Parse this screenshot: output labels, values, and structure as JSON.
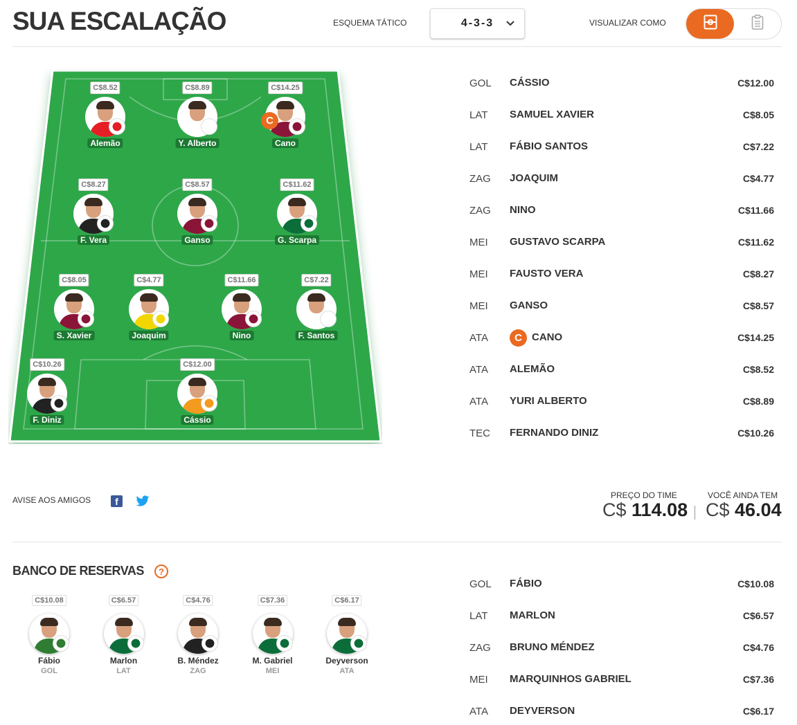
{
  "header": {
    "title": "SUA ESCALAÇÃO",
    "scheme_label": "ESQUEMA TÁTICO",
    "scheme_value": "4-3-3",
    "view_label": "VISUALIZAR COMO",
    "accent_color": "#ea6a21"
  },
  "field": {
    "players": [
      {
        "name": "Alemão",
        "price": "C$8.52",
        "shirt": "#e51f25",
        "club_icon": "internacional-badge-icon"
      },
      {
        "name": "Y. Alberto",
        "price": "C$8.89",
        "shirt": "#ffffff",
        "club_icon": "corinthians-badge-icon"
      },
      {
        "name": "Cano",
        "price": "C$14.25",
        "shirt": "#8a1538",
        "club_icon": "fluminense-badge-icon",
        "captain": "C"
      },
      {
        "name": "F. Vera",
        "price": "C$8.27",
        "shirt": "#222222",
        "club_icon": "corinthians-badge-icon"
      },
      {
        "name": "Ganso",
        "price": "C$8.57",
        "shirt": "#8a1538",
        "club_icon": "fluminense-badge-icon"
      },
      {
        "name": "G. Scarpa",
        "price": "C$11.62",
        "shirt": "#0b6e3a",
        "club_icon": "palmeiras-badge-icon"
      },
      {
        "name": "S. Xavier",
        "price": "C$8.05",
        "shirt": "#8a1538",
        "club_icon": "fluminense-badge-icon"
      },
      {
        "name": "Joaquim",
        "price": "C$4.77",
        "shirt": "#f2d600",
        "club_icon": "cuiaba-badge-icon"
      },
      {
        "name": "Nino",
        "price": "C$11.66",
        "shirt": "#8a1538",
        "club_icon": "fluminense-badge-icon"
      },
      {
        "name": "F. Santos",
        "price": "C$7.22",
        "shirt": "#ffffff",
        "club_icon": "corinthians-badge-icon"
      },
      {
        "name": "F. Diniz",
        "price": "C$10.26",
        "shirt": "#222222",
        "club_icon": "fluminense-badge-icon"
      },
      {
        "name": "Cássio",
        "price": "C$12.00",
        "shirt": "#f39a1f",
        "club_icon": "corinthians-badge-icon"
      }
    ]
  },
  "lineup": [
    {
      "pos": "GOL",
      "name": "CÁSSIO",
      "price": "C$12.00"
    },
    {
      "pos": "LAT",
      "name": "SAMUEL XAVIER",
      "price": "C$8.05"
    },
    {
      "pos": "LAT",
      "name": "FÁBIO SANTOS",
      "price": "C$7.22"
    },
    {
      "pos": "ZAG",
      "name": "JOAQUIM",
      "price": "C$4.77"
    },
    {
      "pos": "ZAG",
      "name": "NINO",
      "price": "C$11.66"
    },
    {
      "pos": "MEI",
      "name": "GUSTAVO SCARPA",
      "price": "C$11.62"
    },
    {
      "pos": "MEI",
      "name": "FAUSTO VERA",
      "price": "C$8.27"
    },
    {
      "pos": "MEI",
      "name": "GANSO",
      "price": "C$8.57"
    },
    {
      "pos": "ATA",
      "name": "CANO",
      "price": "C$14.25",
      "captain": "C"
    },
    {
      "pos": "ATA",
      "name": "ALEMÃO",
      "price": "C$8.52"
    },
    {
      "pos": "ATA",
      "name": "YURI ALBERTO",
      "price": "C$8.89"
    },
    {
      "pos": "TEC",
      "name": "FERNANDO DINIZ",
      "price": "C$10.26"
    }
  ],
  "share": {
    "label": "AVISE AOS AMIGOS",
    "facebook_glyph": "f"
  },
  "totals": {
    "team_price_label": "PREÇO DO TIME",
    "team_price_currency": "C$",
    "team_price_value": "114.08",
    "remaining_label": "VOCÊ AINDA TEM",
    "remaining_currency": "C$",
    "remaining_value": "46.04"
  },
  "bench": {
    "title": "BANCO DE RESERVAS",
    "help_glyph": "?",
    "players": [
      {
        "name": "Fábio",
        "pos": "GOL",
        "price": "C$10.08",
        "shirt": "#2e7d32",
        "club_icon": "fluminense-badge-icon"
      },
      {
        "name": "Marlon",
        "pos": "LAT",
        "price": "C$6.57",
        "shirt": "#0b6e3a",
        "club_icon": "america-mg-badge-icon"
      },
      {
        "name": "B. Méndez",
        "pos": "ZAG",
        "price": "C$4.76",
        "shirt": "#222222",
        "club_icon": "corinthians-badge-icon"
      },
      {
        "name": "M. Gabriel",
        "pos": "MEI",
        "price": "C$7.36",
        "shirt": "#0b6e3a",
        "club_icon": "goias-badge-icon"
      },
      {
        "name": "Deyverson",
        "pos": "ATA",
        "price": "C$6.17",
        "shirt": "#0b6e3a",
        "club_icon": "cuiaba-badge-icon"
      }
    ],
    "list": [
      {
        "pos": "GOL",
        "name": "FÁBIO",
        "price": "C$10.08"
      },
      {
        "pos": "LAT",
        "name": "MARLON",
        "price": "C$6.57"
      },
      {
        "pos": "ZAG",
        "name": "BRUNO MÉNDEZ",
        "price": "C$4.76"
      },
      {
        "pos": "MEI",
        "name": "MARQUINHOS GABRIEL",
        "price": "C$7.36"
      },
      {
        "pos": "ATA",
        "name": "DEYVERSON",
        "price": "C$6.17"
      }
    ]
  }
}
